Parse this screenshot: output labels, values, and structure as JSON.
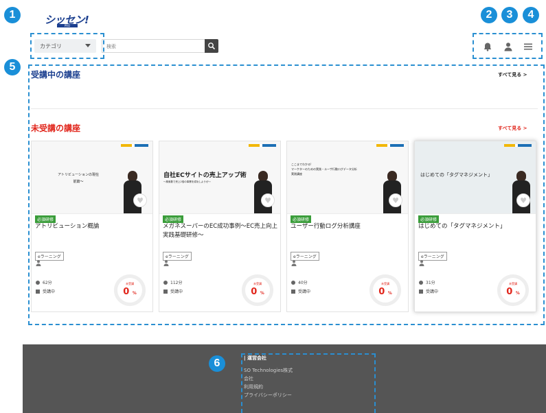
{
  "header": {
    "logo_text": "シッセン!",
    "logo_sub": "PRO",
    "category_label": "カテゴリ",
    "search_placeholder": "検索",
    "icons": [
      "bell-icon",
      "user-icon",
      "menu-icon"
    ]
  },
  "callouts": [
    "1",
    "2",
    "3",
    "4",
    "5",
    "6"
  ],
  "sections": {
    "in_progress": {
      "title": "受講中の講座",
      "see_all": "すべて見る >"
    },
    "not_started": {
      "title": "未受講の講座",
      "see_all": "すべて見る >"
    }
  },
  "courses": [
    {
      "thumb_text": "アトリビューションの現在\n前篇〜",
      "badge": "必須研修",
      "title": "アトリビューション概論",
      "tag": "eラーニング",
      "duration": "62分",
      "status": "受講中",
      "progress_label": "未受講",
      "progress": "0",
      "progress_unit": "%"
    },
    {
      "thumb_text": "自社ECサイトの売上アップ術",
      "thumb_sub": "〜検索数で売上2倍の事業を成功しようぜ〜",
      "badge": "必須研修",
      "title": "メガネスーパーのEC成功事例〜EC売上向上実践基礎研修〜",
      "tag": "eラーニング",
      "duration": "112分",
      "status": "受講中",
      "progress_label": "未受講",
      "progress": "0",
      "progress_unit": "%"
    },
    {
      "thumb_text": "ここまでわかる!\nマーケターのための実践・ユーザ行動ログデータ分析\n実践講座",
      "badge": "必須研修",
      "title": "ユーザー行動ログ分析講座",
      "tag": "eラーニング",
      "duration": "40分",
      "status": "受講中",
      "progress_label": "未受講",
      "progress": "0",
      "progress_unit": "%"
    },
    {
      "thumb_text": "はじめての「タグマネジメント」",
      "badge": "必須研修",
      "title": "はじめての「タグマネジメント」",
      "tag": "eラーニング",
      "duration": "31分",
      "status": "受講中",
      "progress_label": "未受講",
      "progress": "0",
      "progress_unit": "%"
    }
  ],
  "footer": {
    "heading": "| 運営会社",
    "links": [
      "SO Technologies株式会社",
      "利用規約",
      "プライバシーポリシー"
    ]
  },
  "colors": {
    "accent_blue": "#1a8fd8",
    "red": "#e1251b",
    "green_badge": "#3a9d3a",
    "footer_bg": "#555555"
  }
}
